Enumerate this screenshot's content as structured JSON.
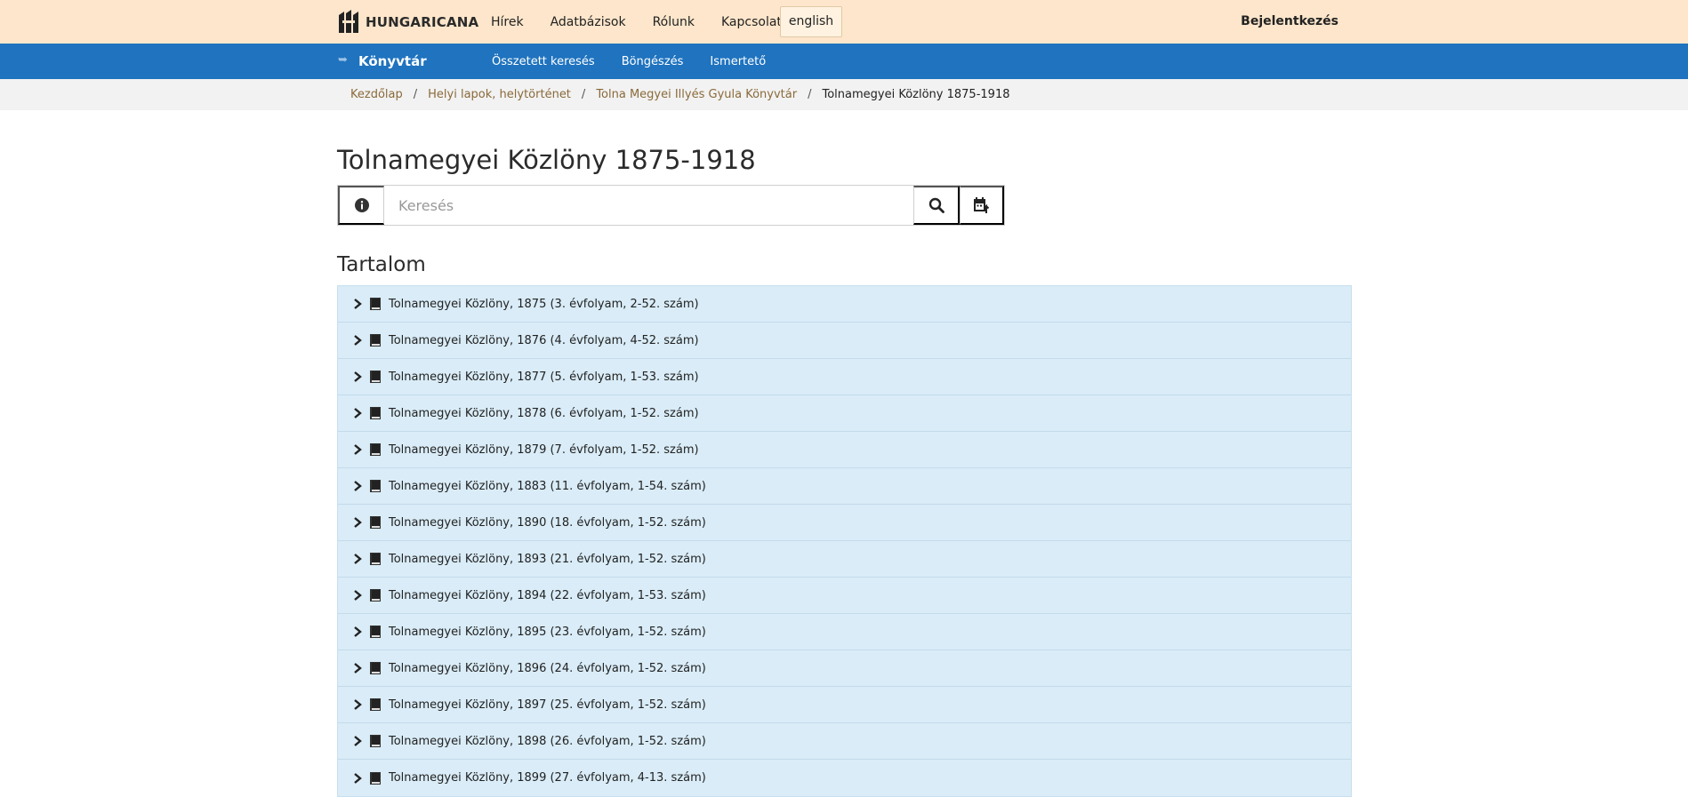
{
  "header": {
    "logo_text": "HUNGARICANA",
    "nav": [
      "Hírek",
      "Adatbázisok",
      "Rólunk",
      "Kapcsolat"
    ],
    "language_button": "english",
    "login": "Bejelentkezés"
  },
  "subheader": {
    "title": "Könyvtár",
    "nav": [
      "Összetett keresés",
      "Böngészés",
      "Ismertető"
    ]
  },
  "breadcrumb": {
    "items": [
      "Kezdőlap",
      "Helyi lapok, helytörténet",
      "Tolna Megyei Illyés Gyula Könyvtár"
    ],
    "separator": "/",
    "current": "Tolnamegyei Közlöny 1875-1918"
  },
  "main": {
    "title": "Tolnamegyei Közlöny 1875-1918",
    "search": {
      "placeholder": "Keresés",
      "value": ""
    },
    "section_title": "Tartalom",
    "items": [
      "Tolnamegyei Közlöny, 1875 (3. évfolyam, 2-52. szám)",
      "Tolnamegyei Közlöny, 1876 (4. évfolyam, 4-52. szám)",
      "Tolnamegyei Közlöny, 1877 (5. évfolyam, 1-53. szám)",
      "Tolnamegyei Közlöny, 1878 (6. évfolyam, 1-52. szám)",
      "Tolnamegyei Közlöny, 1879 (7. évfolyam, 1-52. szám)",
      "Tolnamegyei Közlöny, 1883 (11. évfolyam, 1-54. szám)",
      "Tolnamegyei Közlöny, 1890 (18. évfolyam, 1-52. szám)",
      "Tolnamegyei Közlöny, 1893 (21. évfolyam, 1-52. szám)",
      "Tolnamegyei Közlöny, 1894 (22. évfolyam, 1-53. szám)",
      "Tolnamegyei Közlöny, 1895 (23. évfolyam, 1-52. szám)",
      "Tolnamegyei Közlöny, 1896 (24. évfolyam, 1-52. szám)",
      "Tolnamegyei Közlöny, 1897 (25. évfolyam, 1-52. szám)",
      "Tolnamegyei Közlöny, 1898 (26. évfolyam, 1-52. szám)",
      "Tolnamegyei Közlöny, 1899 (27. évfolyam, 4-13. szám)"
    ]
  },
  "icons": {
    "logo": "hungaricana-logo-icon",
    "library": "library-arrow-icon",
    "info": "info-circle-icon",
    "search": "search-icon",
    "export": "calendar-export-icon",
    "expand": "chevron-right-icon",
    "book": "book-icon"
  },
  "colors": {
    "topbar": "#fde6cb",
    "bluebar": "#1f73bf",
    "breadcrumb_bar": "#f2f2f2",
    "breadcrumb_link": "#8a6a3a",
    "list_background": "#d9ecf7"
  }
}
